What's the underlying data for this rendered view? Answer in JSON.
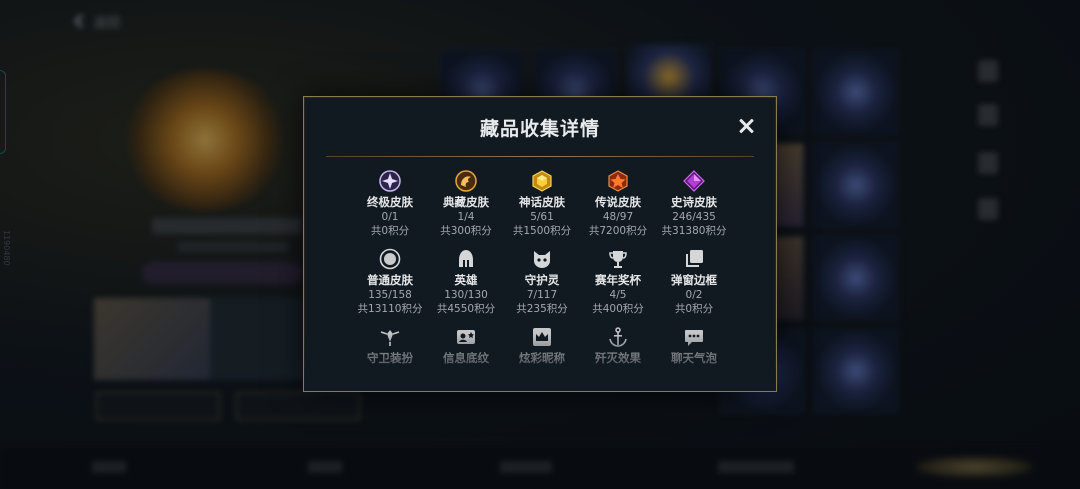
{
  "background": {
    "back_label": "返回",
    "vertical_code": "1190480"
  },
  "modal": {
    "title": "藏品收集详情",
    "close_icon": "close-icon",
    "items": [
      {
        "label": "终极皮肤",
        "count": "0/1",
        "points": "共0积分",
        "icon": "ultimate-gem-icon",
        "color": "#b9a6e8"
      },
      {
        "label": "典藏皮肤",
        "count": "1/4",
        "points": "共300积分",
        "icon": "dragon-crest-icon",
        "color": "#d89a2c"
      },
      {
        "label": "神话皮肤",
        "count": "5/61",
        "points": "共1500积分",
        "icon": "mythic-gem-icon",
        "color": "#e6b422"
      },
      {
        "label": "传说皮肤",
        "count": "48/97",
        "points": "共7200积分",
        "icon": "legend-gem-icon",
        "color": "#e8602a"
      },
      {
        "label": "史诗皮肤",
        "count": "246/435",
        "points": "共31380积分",
        "icon": "epic-gem-icon",
        "color": "#b23ed6"
      },
      {
        "label": "普通皮肤",
        "count": "135/158",
        "points": "共13110积分",
        "icon": "common-skin-icon",
        "color": "#d4d6d8"
      },
      {
        "label": "英雄",
        "count": "130/130",
        "points": "共4550积分",
        "icon": "helmet-icon",
        "color": "#d4d6d8"
      },
      {
        "label": "守护灵",
        "count": "7/117",
        "points": "共235积分",
        "icon": "guardian-spirit-icon",
        "color": "#d4d6d8"
      },
      {
        "label": "赛年奖杯",
        "count": "4/5",
        "points": "共400积分",
        "icon": "trophy-icon",
        "color": "#d4d6d8"
      },
      {
        "label": "弹窗边框",
        "count": "0/2",
        "points": "共0积分",
        "icon": "frame-icon",
        "color": "#d4d6d8"
      },
      {
        "label": "守卫装扮",
        "icon": "ward-icon",
        "color": "#c4c6c8"
      },
      {
        "label": "信息底纹",
        "icon": "profile-card-icon",
        "color": "#c4c6c8"
      },
      {
        "label": "炫彩昵称",
        "icon": "crown-badge-icon",
        "color": "#c4c6c8"
      },
      {
        "label": "歼灭效果",
        "icon": "anchor-icon",
        "color": "#c4c6c8"
      },
      {
        "label": "聊天气泡",
        "icon": "chat-bubble-icon",
        "color": "#c4c6c8"
      }
    ]
  }
}
